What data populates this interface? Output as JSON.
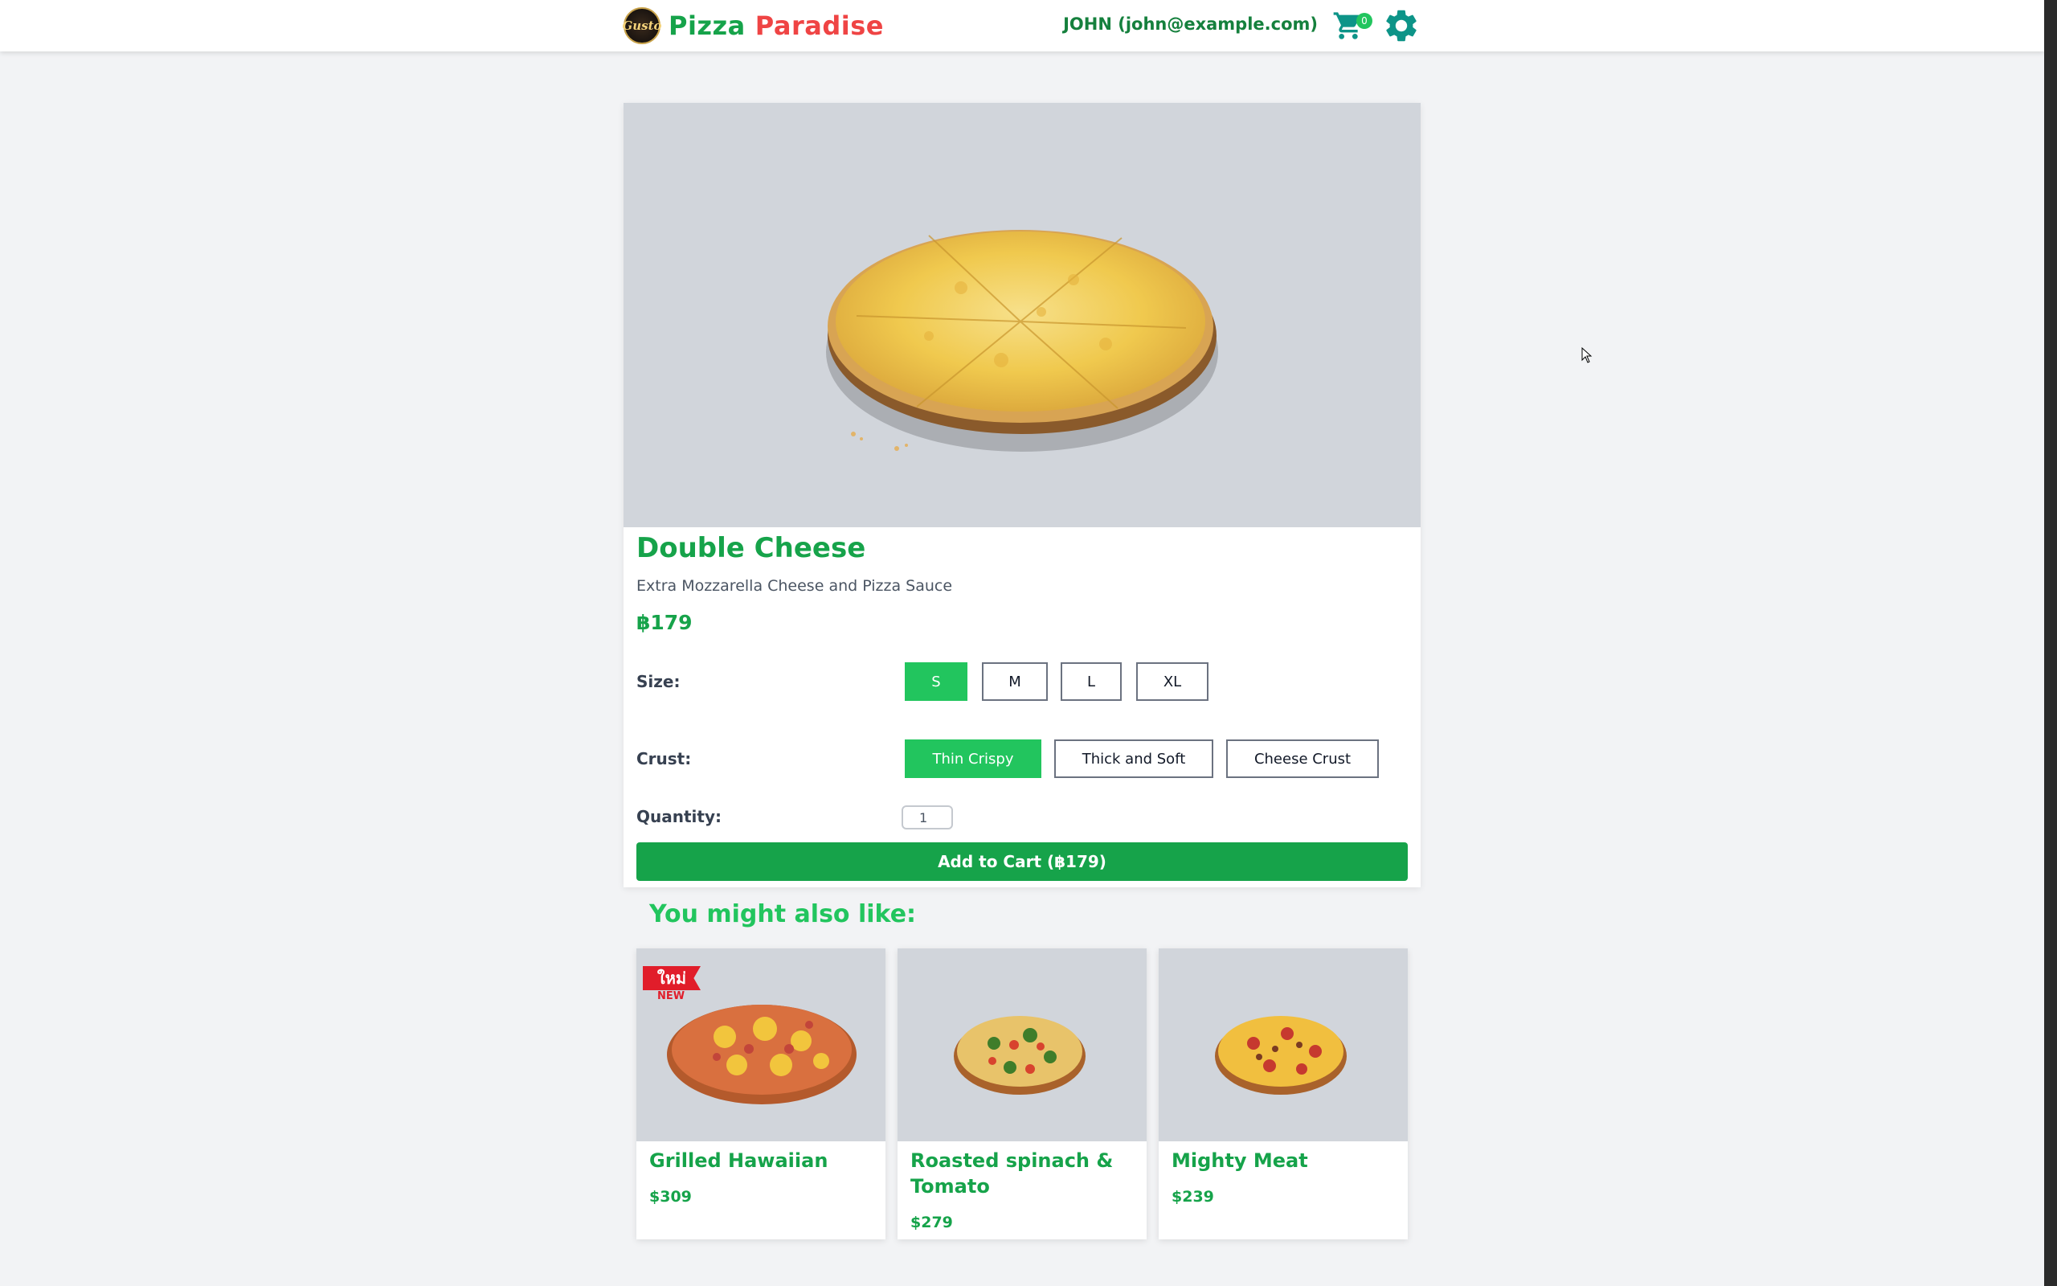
{
  "header": {
    "logo_text": "Gusto",
    "brand_first": "Pizza",
    "brand_second": "Paradise",
    "user_label": "JOHN (john@example.com)",
    "cart_count": "0"
  },
  "product": {
    "name": "Double Cheese",
    "description": "Extra Mozzarella Cheese and Pizza Sauce",
    "price": "฿179",
    "size_label": "Size:",
    "sizes": [
      "S",
      "M",
      "L",
      "XL"
    ],
    "selected_size": "S",
    "crust_label": "Crust:",
    "crusts": [
      "Thin Crispy",
      "Thick and Soft",
      "Cheese Crust"
    ],
    "selected_crust": "Thin Crispy",
    "quantity_label": "Quantity:",
    "quantity": "1",
    "add_to_cart": "Add to Cart (฿179)"
  },
  "recommendations": {
    "title": "You might also like:",
    "items": [
      {
        "name": "Grilled Hawaiian",
        "price": "$309",
        "badge_thai": "ใหม่",
        "badge_new": "NEW"
      },
      {
        "name": "Roasted spinach & Tomato",
        "price": "$279"
      },
      {
        "name": "Mighty Meat",
        "price": "$239"
      }
    ]
  },
  "colors": {
    "primary": "#16a34a",
    "accent_light": "#22c55e",
    "brand_red": "#ef4444",
    "image_bg": "#d1d5db",
    "page_bg": "#f2f3f5"
  },
  "icons": [
    "logo-icon",
    "cart-icon",
    "gear-icon"
  ]
}
